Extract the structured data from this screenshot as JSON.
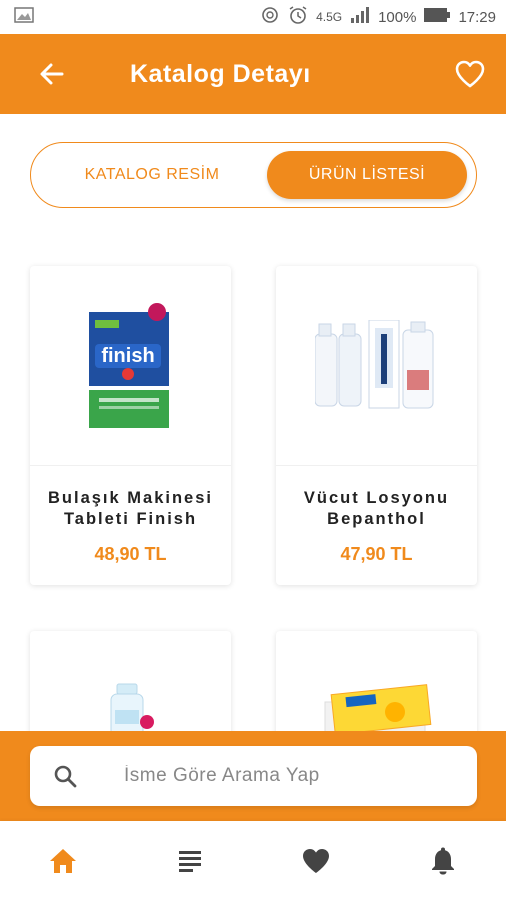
{
  "status_bar": {
    "network": "4.5G",
    "battery": "100%",
    "time": "17:29"
  },
  "header": {
    "title": "Katalog Detayı",
    "back_icon": "arrow-left-icon",
    "favorite_icon": "heart-outline-icon"
  },
  "tabs": [
    {
      "label": "KATALOG RESİM",
      "active": false
    },
    {
      "label": "ÜRÜN LİSTESİ",
      "active": true
    }
  ],
  "products": [
    {
      "name_line1": "Bulaşık Makinesi",
      "name_line2": "Tableti Finish",
      "price": "48,90 TL"
    },
    {
      "name_line1": "Vücut Losyonu",
      "name_line2": "Bepanthol",
      "price": "47,90 TL"
    },
    {
      "name_line1": "",
      "name_line2": "",
      "price": ""
    },
    {
      "name_line1": "",
      "name_line2": "",
      "price": ""
    }
  ],
  "search": {
    "placeholder": "İsme Göre Arama Yap"
  },
  "bottom_nav": [
    {
      "icon": "home-icon",
      "active": true
    },
    {
      "icon": "list-icon",
      "active": false
    },
    {
      "icon": "heart-icon",
      "active": false
    },
    {
      "icon": "bell-icon",
      "active": false
    }
  ],
  "colors": {
    "accent": "#f08a1c",
    "inactive_icon": "#444444"
  }
}
